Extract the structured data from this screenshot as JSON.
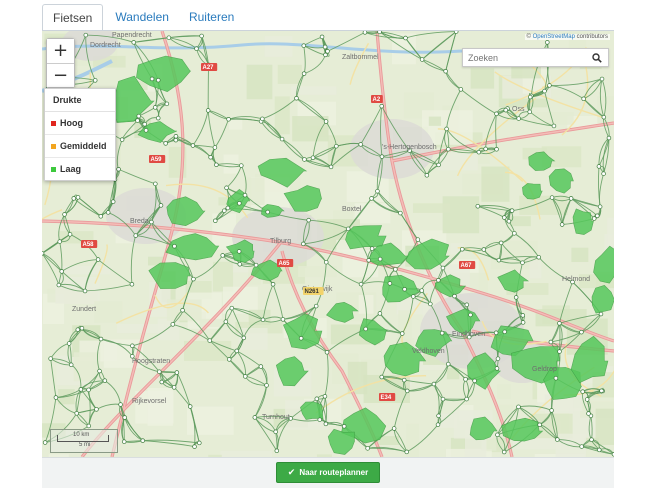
{
  "tabs": [
    {
      "label": "Fietsen",
      "active": true
    },
    {
      "label": "Wandelen",
      "active": false
    },
    {
      "label": "Ruiteren",
      "active": false
    }
  ],
  "map": {
    "attribution_prefix": "© ",
    "attribution_link": "OpenStreetMap",
    "attribution_suffix": " contributors",
    "zoom_in_label": "+",
    "zoom_out_label": "−",
    "search_placeholder": "Zoeken",
    "search_icon": "magnifier-icon",
    "scale_label_top": "10 km",
    "scale_label_bottom": "5 mi",
    "place_labels": [
      "Papendrecht",
      "Dordrecht",
      "Zaltbommel",
      "'s-Hertogenbosch",
      "Breda",
      "Tilburg",
      "Zundert",
      "Eindhoven",
      "Hoogstraten",
      "Rijkevorsel",
      "Turnhout",
      "Geldrop",
      "Veldhoven",
      "Oisterwijk",
      "Boxtel",
      "Oss",
      "Helmond"
    ],
    "road_labels": [
      "A27",
      "A2",
      "A59",
      "A58",
      "A65",
      "A67",
      "E34",
      "N261"
    ]
  },
  "legend": {
    "title": "Drukte",
    "items": [
      {
        "label": "Hoog",
        "color": "#e0261f"
      },
      {
        "label": "Gemiddeld",
        "color": "#f2a51f"
      },
      {
        "label": "Laag",
        "color": "#3dc93d"
      }
    ]
  },
  "footer": {
    "route_button": "Naar routeplanner",
    "route_icon": "check-icon"
  },
  "colors": {
    "accent": "#2a7bbd",
    "button_green": "#3daa46",
    "area_green": "#56c85c",
    "route_green": "#4f8c4f"
  }
}
